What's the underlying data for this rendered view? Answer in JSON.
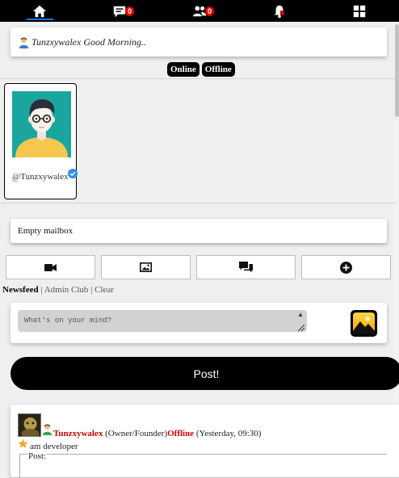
{
  "nav": {
    "items": [
      {
        "icon": "home-icon",
        "active": true
      },
      {
        "icon": "messages-icon",
        "badge": "0"
      },
      {
        "icon": "friends-icon",
        "badge": "0"
      },
      {
        "icon": "notifications-icon"
      },
      {
        "icon": "grid-menu-icon"
      }
    ]
  },
  "greeting": {
    "text": "Tunzxywalex Good Morning.."
  },
  "status_pills": {
    "online": "Online",
    "offline": "Offline"
  },
  "profile": {
    "handle": "@Tunzxywalex",
    "verified": true
  },
  "mailbox": {
    "text": "Empty mailbox"
  },
  "actions": [
    {
      "icon": "video-icon"
    },
    {
      "icon": "image-icon"
    },
    {
      "icon": "chat-icon"
    },
    {
      "icon": "plus-circle-icon"
    }
  ],
  "feed_tabs": {
    "newsfeed": "Newsfeed",
    "admin_club": "Admin Club",
    "clear": "Clear",
    "separator": "|"
  },
  "composer": {
    "placeholder": "What's on your mind?"
  },
  "post_button": {
    "label": "Post!"
  },
  "feed_post": {
    "username": "Tunzxywalex",
    "role": "(Owner/Founder)",
    "status": "Offline",
    "time": "(Yesterday, 09:30)",
    "bio": "am developer",
    "post_label": "Post:"
  },
  "colors": {
    "accent": "#1a73e8",
    "badge": "#e10000",
    "offline": "#e00000",
    "avatar_bg": "#1aa69f"
  }
}
